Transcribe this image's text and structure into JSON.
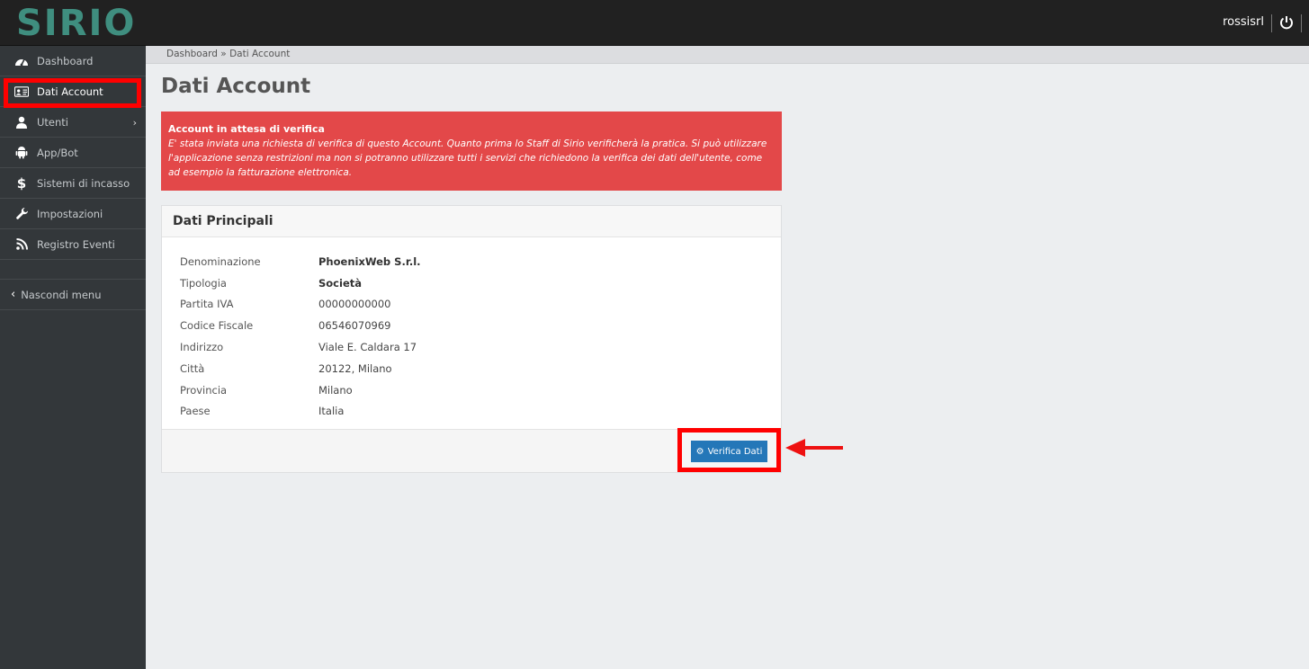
{
  "app": {
    "logo": "SIRIO",
    "user": "rossisrl"
  },
  "sidebar": {
    "items": [
      {
        "label": "Dashboard",
        "icon": "dashboard-icon"
      },
      {
        "label": "Dati Account",
        "icon": "id-card-icon"
      },
      {
        "label": "Utenti",
        "icon": "user-icon"
      },
      {
        "label": "App/Bot",
        "icon": "android-icon"
      },
      {
        "label": "Sistemi di incasso",
        "icon": "dollar-icon"
      },
      {
        "label": "Impostazioni",
        "icon": "wrench-icon"
      },
      {
        "label": "Registro Eventi",
        "icon": "rss-icon"
      }
    ],
    "hide_label": "Nascondi menu"
  },
  "breadcrumb": "Dashboard » Dati Account",
  "page_title": "Dati Account",
  "alert": {
    "title": "Account in attesa di verifica",
    "text": "E' stata inviata una richiesta di verifica di questo Account. Quanto prima lo Staff di Sirio verificherà la pratica. Si può utilizzare l'applicazione senza restrizioni ma non si potranno utilizzare tutti i servizi che richiedono la verifica dei dati dell'utente, come ad esempio la fatturazione elettronica."
  },
  "panel": {
    "title": "Dati Principali",
    "rows": [
      {
        "key": "Denominazione",
        "value": "PhoenixWeb S.r.l."
      },
      {
        "key": "Tipologia",
        "value": "Società"
      },
      {
        "key": "Partita IVA",
        "value": "00000000000"
      },
      {
        "key": "Codice Fiscale",
        "value": "06546070969"
      },
      {
        "key": "Indirizzo",
        "value": "Viale E. Caldara 17"
      },
      {
        "key": "Città",
        "value": "20122, Milano"
      },
      {
        "key": "Provincia",
        "value": "Milano"
      },
      {
        "key": "Paese",
        "value": "Italia"
      }
    ],
    "button_label": "Verifica Dati"
  },
  "colors": {
    "accent": "#2477b8",
    "alert": "#e34849",
    "highlight": "#ff0000",
    "logo": "#3f8e7f"
  }
}
